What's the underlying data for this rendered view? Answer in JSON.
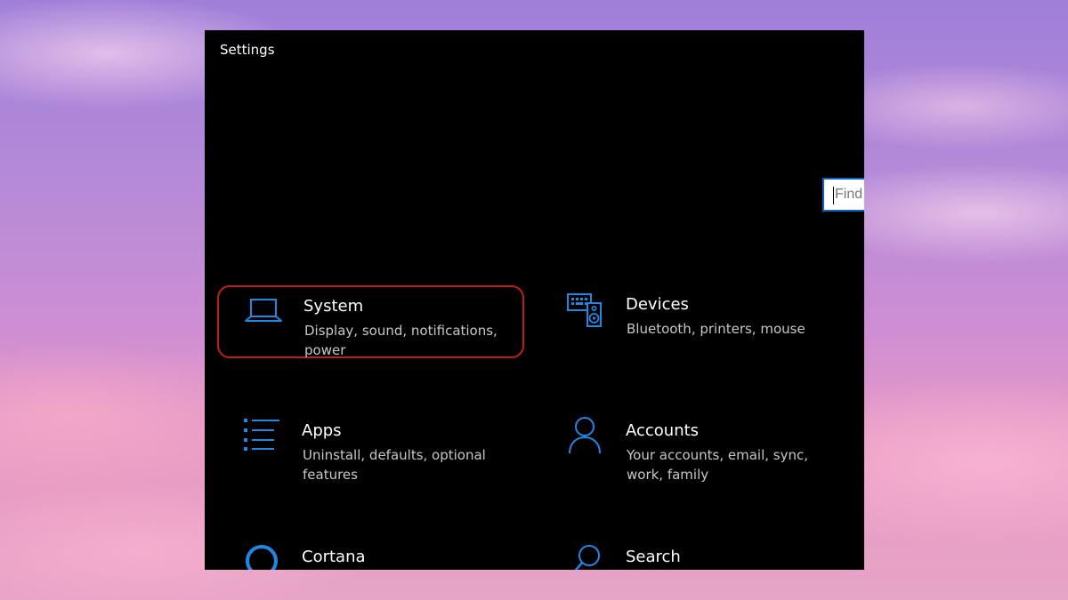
{
  "window": {
    "title": "Settings"
  },
  "search": {
    "placeholder": "Find a setting"
  },
  "tiles": [
    {
      "label": "System",
      "description": "Display, sound, notifications, power",
      "icon": "laptop-icon"
    },
    {
      "label": "Devices",
      "description": "Bluetooth, printers, mouse",
      "icon": "keyboard-speaker-icon"
    },
    {
      "label": "Apps",
      "description": "Uninstall, defaults, optional features",
      "icon": "apps-list-icon"
    },
    {
      "label": "Accounts",
      "description": "Your accounts, email, sync, work, family",
      "icon": "person-icon"
    },
    {
      "label": "Cortana",
      "description": "",
      "icon": "cortana-circle-icon"
    },
    {
      "label": "Search",
      "description": "",
      "icon": "magnifier-icon"
    }
  ],
  "colors": {
    "icon_blue": "#1e88e5",
    "highlight_red": "#c21b1b",
    "search_border": "#0a63c9"
  }
}
